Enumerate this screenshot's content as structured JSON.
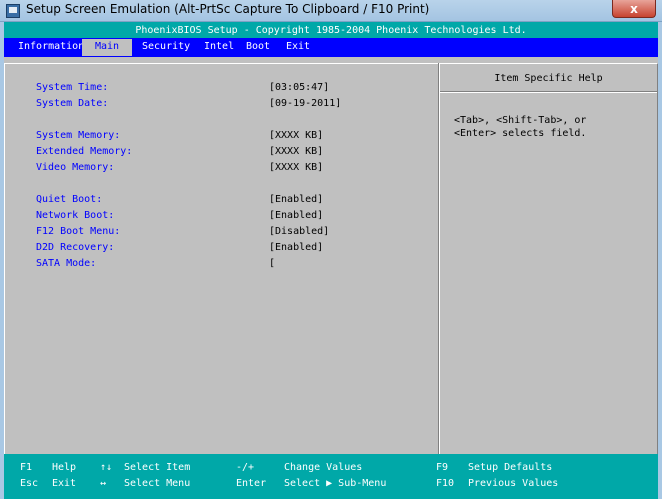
{
  "window": {
    "title": "Setup Screen Emulation (Alt-PrtSc Capture To Clipboard / F10 Print)",
    "close_label": "x"
  },
  "bios": {
    "header": "PhoenixBIOS Setup - Copyright 1985-2004 Phoenix Technologies Ltd.",
    "menu": [
      "Information",
      "Main",
      "Security",
      "Intel",
      "Boot",
      "Exit"
    ],
    "active_menu": "Main",
    "help_title": "Item Specific Help",
    "help_text": "<Tab>, <Shift-Tab>, or\n<Enter> selects field.",
    "fields": [
      {
        "label": "System Time:",
        "value": "[03:05:47]"
      },
      {
        "label": "System Date:",
        "value": "[09-19-2011]"
      },
      {
        "label": "System Memory:",
        "value": "[XXXX KB]"
      },
      {
        "label": "Extended Memory:",
        "value": "[XXXX KB]"
      },
      {
        "label": "Video Memory:",
        "value": "[XXXX KB]"
      },
      {
        "label": "Quiet Boot:",
        "value": "[Enabled]"
      },
      {
        "label": "Network Boot:",
        "value": "[Enabled]"
      },
      {
        "label": "F12 Boot Menu:",
        "value": "[Disabled]"
      },
      {
        "label": "D2D Recovery:",
        "value": "[Enabled]"
      },
      {
        "label": "SATA Mode:",
        "value": "["
      }
    ],
    "footer": {
      "row1": {
        "k1": "F1",
        "a1": "Help",
        "k2": "↑↓",
        "a2": "Select Item",
        "k3": "-/+",
        "a3": "Change Values",
        "k4": "F9",
        "a4": "Setup Defaults"
      },
      "row2": {
        "k1": "Esc",
        "a1": "Exit",
        "k2": "↔",
        "a2": "Select Menu",
        "k3": "Enter",
        "a3": "Select ▶ Sub-Menu",
        "k4": "F10",
        "a4": "Previous Values"
      }
    }
  }
}
